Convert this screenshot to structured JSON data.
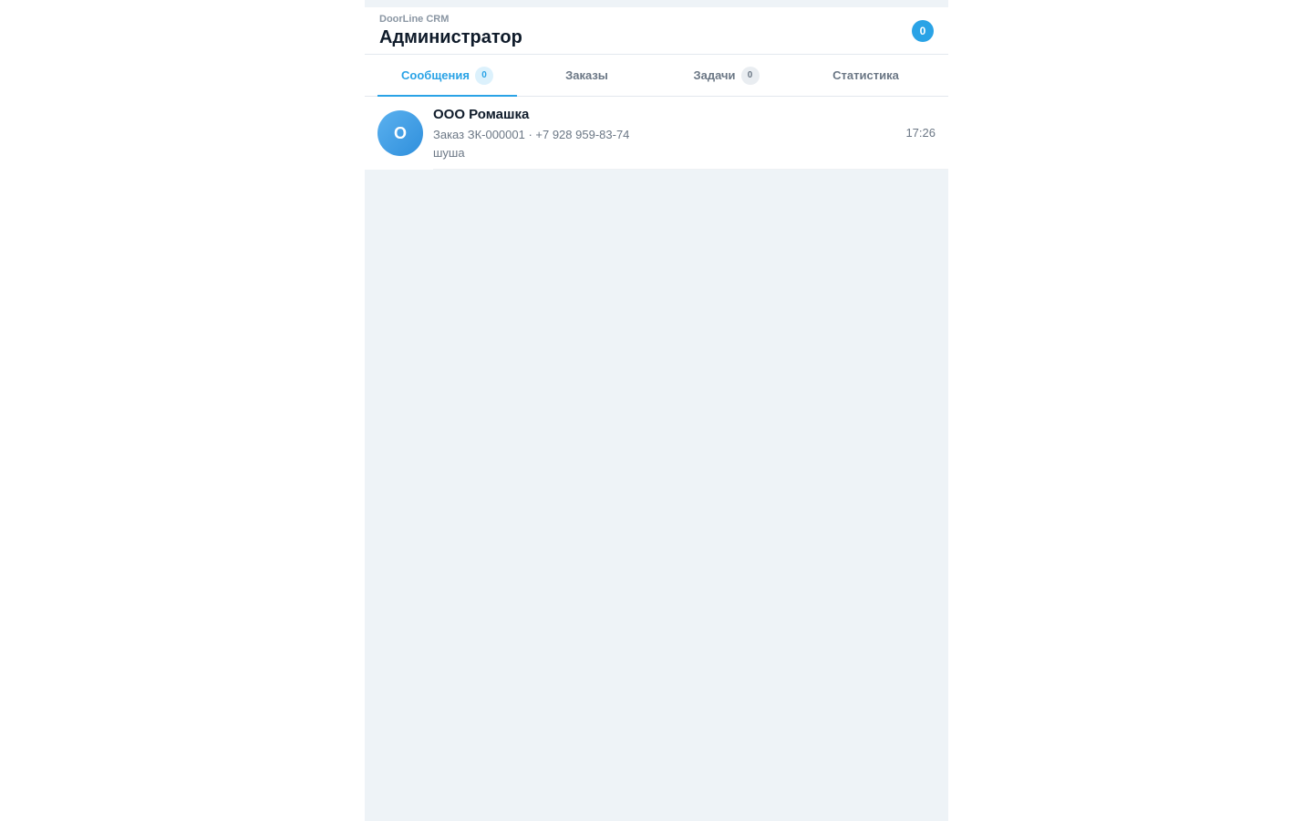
{
  "header": {
    "brand": "DoorLine CRM",
    "title": "Администратор",
    "badge_count": "0"
  },
  "tabs": [
    {
      "label": "Сообщения",
      "count": "0",
      "active": true
    },
    {
      "label": "Заказы",
      "count": null,
      "active": false
    },
    {
      "label": "Задачи",
      "count": "0",
      "active": false
    },
    {
      "label": "Статистика",
      "count": null,
      "active": false
    }
  ],
  "chats": [
    {
      "avatar_letter": "О",
      "name": "ООО Ромашка",
      "subtitle": "Заказ ЗК-000001 · +7 928 959-83-74",
      "last_message": "шуша",
      "time": "17:26"
    }
  ],
  "colors": {
    "accent": "#2aa3e6",
    "background": "#eef3f7",
    "text_primary": "#0f1b2a",
    "text_secondary": "#6b7785"
  }
}
